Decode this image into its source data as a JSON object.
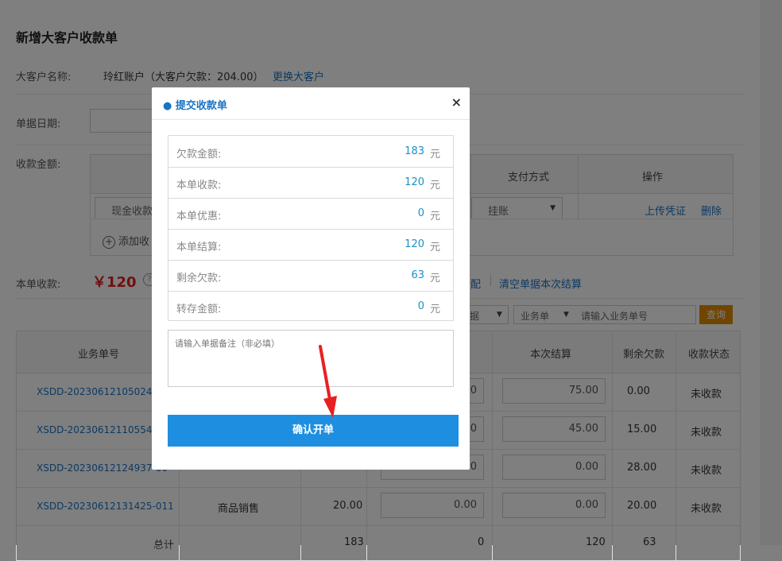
{
  "page": {
    "title": "新增大客户收款单",
    "customer_label": "大客户名称:",
    "customer_value": "玲红账户（大客户欠款：204.00）",
    "change_customer": "更换大客户",
    "date_label": "单据日期:",
    "amount_label": "收款金额:",
    "pay_headers": {
      "method": "支付方式",
      "action": "操作"
    },
    "cash_select": "现金收款",
    "pay_method": "挂账",
    "upload": "上传凭证",
    "delete": "删除",
    "add_line": "添加收",
    "this_receipt_label": "本单收款:",
    "this_receipt_value": "￥120",
    "match_link": "配",
    "clear_link": "清空单据本次结算",
    "filter1": "据",
    "filter2": "业务单",
    "filter_placeholder": "请输入业务单号",
    "query": "查询",
    "grid_headers": {
      "order_no": "业务单号",
      "settle": "本次结算",
      "remain": "剩余欠款",
      "status": "收款状态"
    },
    "rows": [
      {
        "order_no": "XSDD-20230612105024-69",
        "settle": "75.00",
        "remain": "0.00",
        "status": "未收款"
      },
      {
        "order_no": "XSDD-20230612110554-03",
        "settle": "45.00",
        "remain": "15.00",
        "status": "未收款"
      },
      {
        "order_no": "XSDD-20230612124937-00",
        "settle": "0.00",
        "remain": "28.00",
        "status": "未收款"
      },
      {
        "order_no": "XSDD-20230612131425-011",
        "type": "商品销售",
        "amount": "20.00",
        "paid": "0.00",
        "settle": "0.00",
        "remain": "20.00",
        "status": "未收款"
      }
    ],
    "totals": {
      "label": "总计",
      "amount": "183",
      "paid": "0",
      "settle": "120",
      "remain": "63"
    }
  },
  "modal": {
    "title": "● 提交收款单",
    "close": "×",
    "unit": "元",
    "items": [
      {
        "label": "欠款金额:",
        "value": "183"
      },
      {
        "label": "本单收款:",
        "value": "120"
      },
      {
        "label": "本单优惠:",
        "value": "0"
      },
      {
        "label": "本单结算:",
        "value": "120"
      },
      {
        "label": "剩余欠款:",
        "value": "63"
      },
      {
        "label": "转存金额:",
        "value": "0"
      }
    ],
    "remark_placeholder": "请输入单据备注（非必填）",
    "confirm": "确认开单"
  },
  "colors": {
    "accent": "#1e8fe0",
    "link": "#1a73c4",
    "price": "#e02020",
    "query": "#e08a00",
    "arrow": "#e82020"
  }
}
